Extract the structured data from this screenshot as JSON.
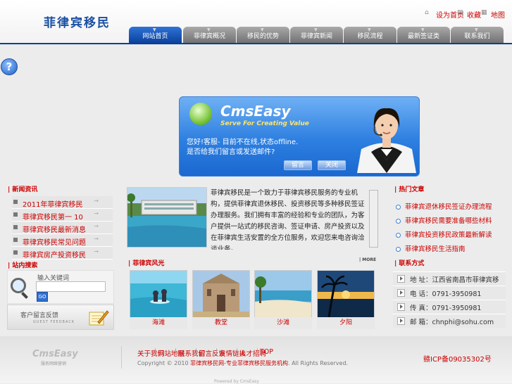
{
  "brand": {
    "name": "菲律宾移民"
  },
  "toplinks": [
    {
      "icon": "home-icon",
      "label": "设为首页"
    },
    {
      "icon": "bookmark-icon",
      "label": "收藏"
    },
    {
      "icon": "sitemap-icon",
      "label": "地图"
    }
  ],
  "nav": {
    "tabs": [
      "网站首页",
      "菲律宾概况",
      "移民的优势",
      "菲律宾新闻",
      "移民流程",
      "最新签证类",
      "联系我们"
    ],
    "active": 0
  },
  "dialog": {
    "logo": "CmsEasy",
    "slogan": "Serve For Creating Value",
    "message_line1": "您好!客服- 目前不在线,状态offline.",
    "message_line2": "是否给我们留言或发送邮件?",
    "buttons": [
      "留言",
      "关闭"
    ]
  },
  "left": {
    "news_title": "新闻资讯",
    "news_items": [
      "2011年菲律宾移民",
      "菲律宾移民第一 10",
      "菲律宾移民最新消息",
      "菲律宾移民常见问题",
      "菲律宾房产投资移民"
    ],
    "search_title": "站内搜索",
    "search_label": "输入关键词",
    "search_placeholder": "",
    "search_go": "GO",
    "feedback_title": "客户留言反馈",
    "feedback_sub": "GUEST FEEDBACK"
  },
  "center": {
    "about_text": "菲律宾移民是一个致力于菲律宾移民服务的专业机构，提供菲律宾退休移民、投资移民等多种移民签证办理服务。我们拥有丰富的经验和专业的团队，为客户提供一站式的移民咨询、签证申请、房产投资以及在菲律宾生活安置的全方位服务，欢迎您来电咨询洽谈业务。",
    "photos_title": "菲律宾风光",
    "more": "MORE",
    "photos": [
      "海滩",
      "教堂",
      "沙滩",
      "夕阳"
    ]
  },
  "right": {
    "hot_title": "热门文章",
    "hot_items": [
      "菲律宾退休移民签证办理流程",
      "菲律宾移民需要准备哪些材料",
      "菲律宾投资移民政策最新解读",
      "菲律宾移民生活指南"
    ],
    "contact_title": "联系方式",
    "contact_items": [
      "地 址：江西省南昌市菲律宾移民",
      "电 话：0791-3950981",
      "传 真：0791-3950981",
      "邮 箱：chnphi@sohu.com"
    ]
  },
  "footer": {
    "logo": "CmsEasy",
    "logo_sub": "服务网络营销",
    "links": [
      "关于我们",
      "网站地图",
      "联系我们",
      "留言反馈",
      "友情链接",
      "人才招聘"
    ],
    "top": "TOP",
    "copyright_prefix": "Copyright © 2010",
    "copyright_company": "菲律宾移民网-专业菲律宾移民服务机构",
    "copyright_suffix": ". All Rights Reserved.",
    "icp": "赣ICP备09035302号",
    "powered": "Powered by CmsEasy"
  },
  "colors": {
    "accent_red": "#cc0000",
    "nav_blue": "#0a3f9a",
    "dialog_blue": "#2d7fe0"
  }
}
